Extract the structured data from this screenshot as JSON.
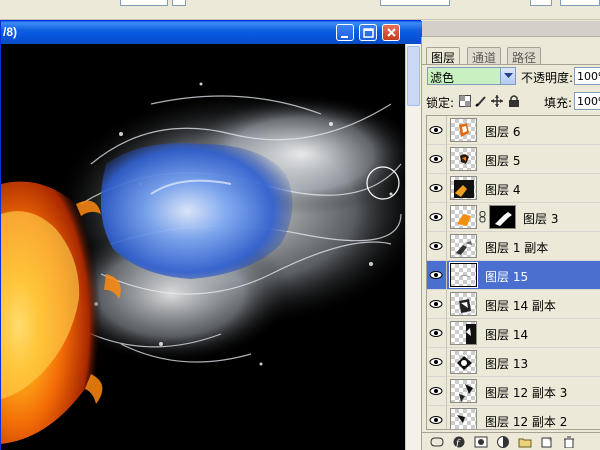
{
  "document": {
    "title_fragment": "/8)"
  },
  "panel": {
    "tabs": [
      "图层",
      "通道",
      "路径"
    ],
    "blend_mode": "滤色",
    "opacity_label": "不透明度:",
    "opacity_value": "100%",
    "lock_label": "锁定:",
    "fill_label": "填充:",
    "fill_value": "100%"
  },
  "layers": [
    {
      "name": "图层 6",
      "visible": true,
      "selected": false
    },
    {
      "name": "图层 5",
      "visible": true,
      "selected": false
    },
    {
      "name": "图层 4",
      "visible": true,
      "selected": false
    },
    {
      "name": "图层 3",
      "visible": true,
      "selected": false,
      "has_mask": true
    },
    {
      "name": "图层 1 副本",
      "visible": true,
      "selected": false
    },
    {
      "name": "图层 15",
      "visible": true,
      "selected": true
    },
    {
      "name": "图层 14 副本",
      "visible": true,
      "selected": false
    },
    {
      "name": "图层 14",
      "visible": true,
      "selected": false
    },
    {
      "name": "图层 13",
      "visible": true,
      "selected": false
    },
    {
      "name": "图层 12 副本 3",
      "visible": true,
      "selected": false
    },
    {
      "name": "图层 12 副本 2",
      "visible": true,
      "selected": false
    }
  ],
  "colors": {
    "titlebar": "#0a58e7",
    "selection": "#4a6fce",
    "blend_select_bg": "#c8f0c0"
  }
}
